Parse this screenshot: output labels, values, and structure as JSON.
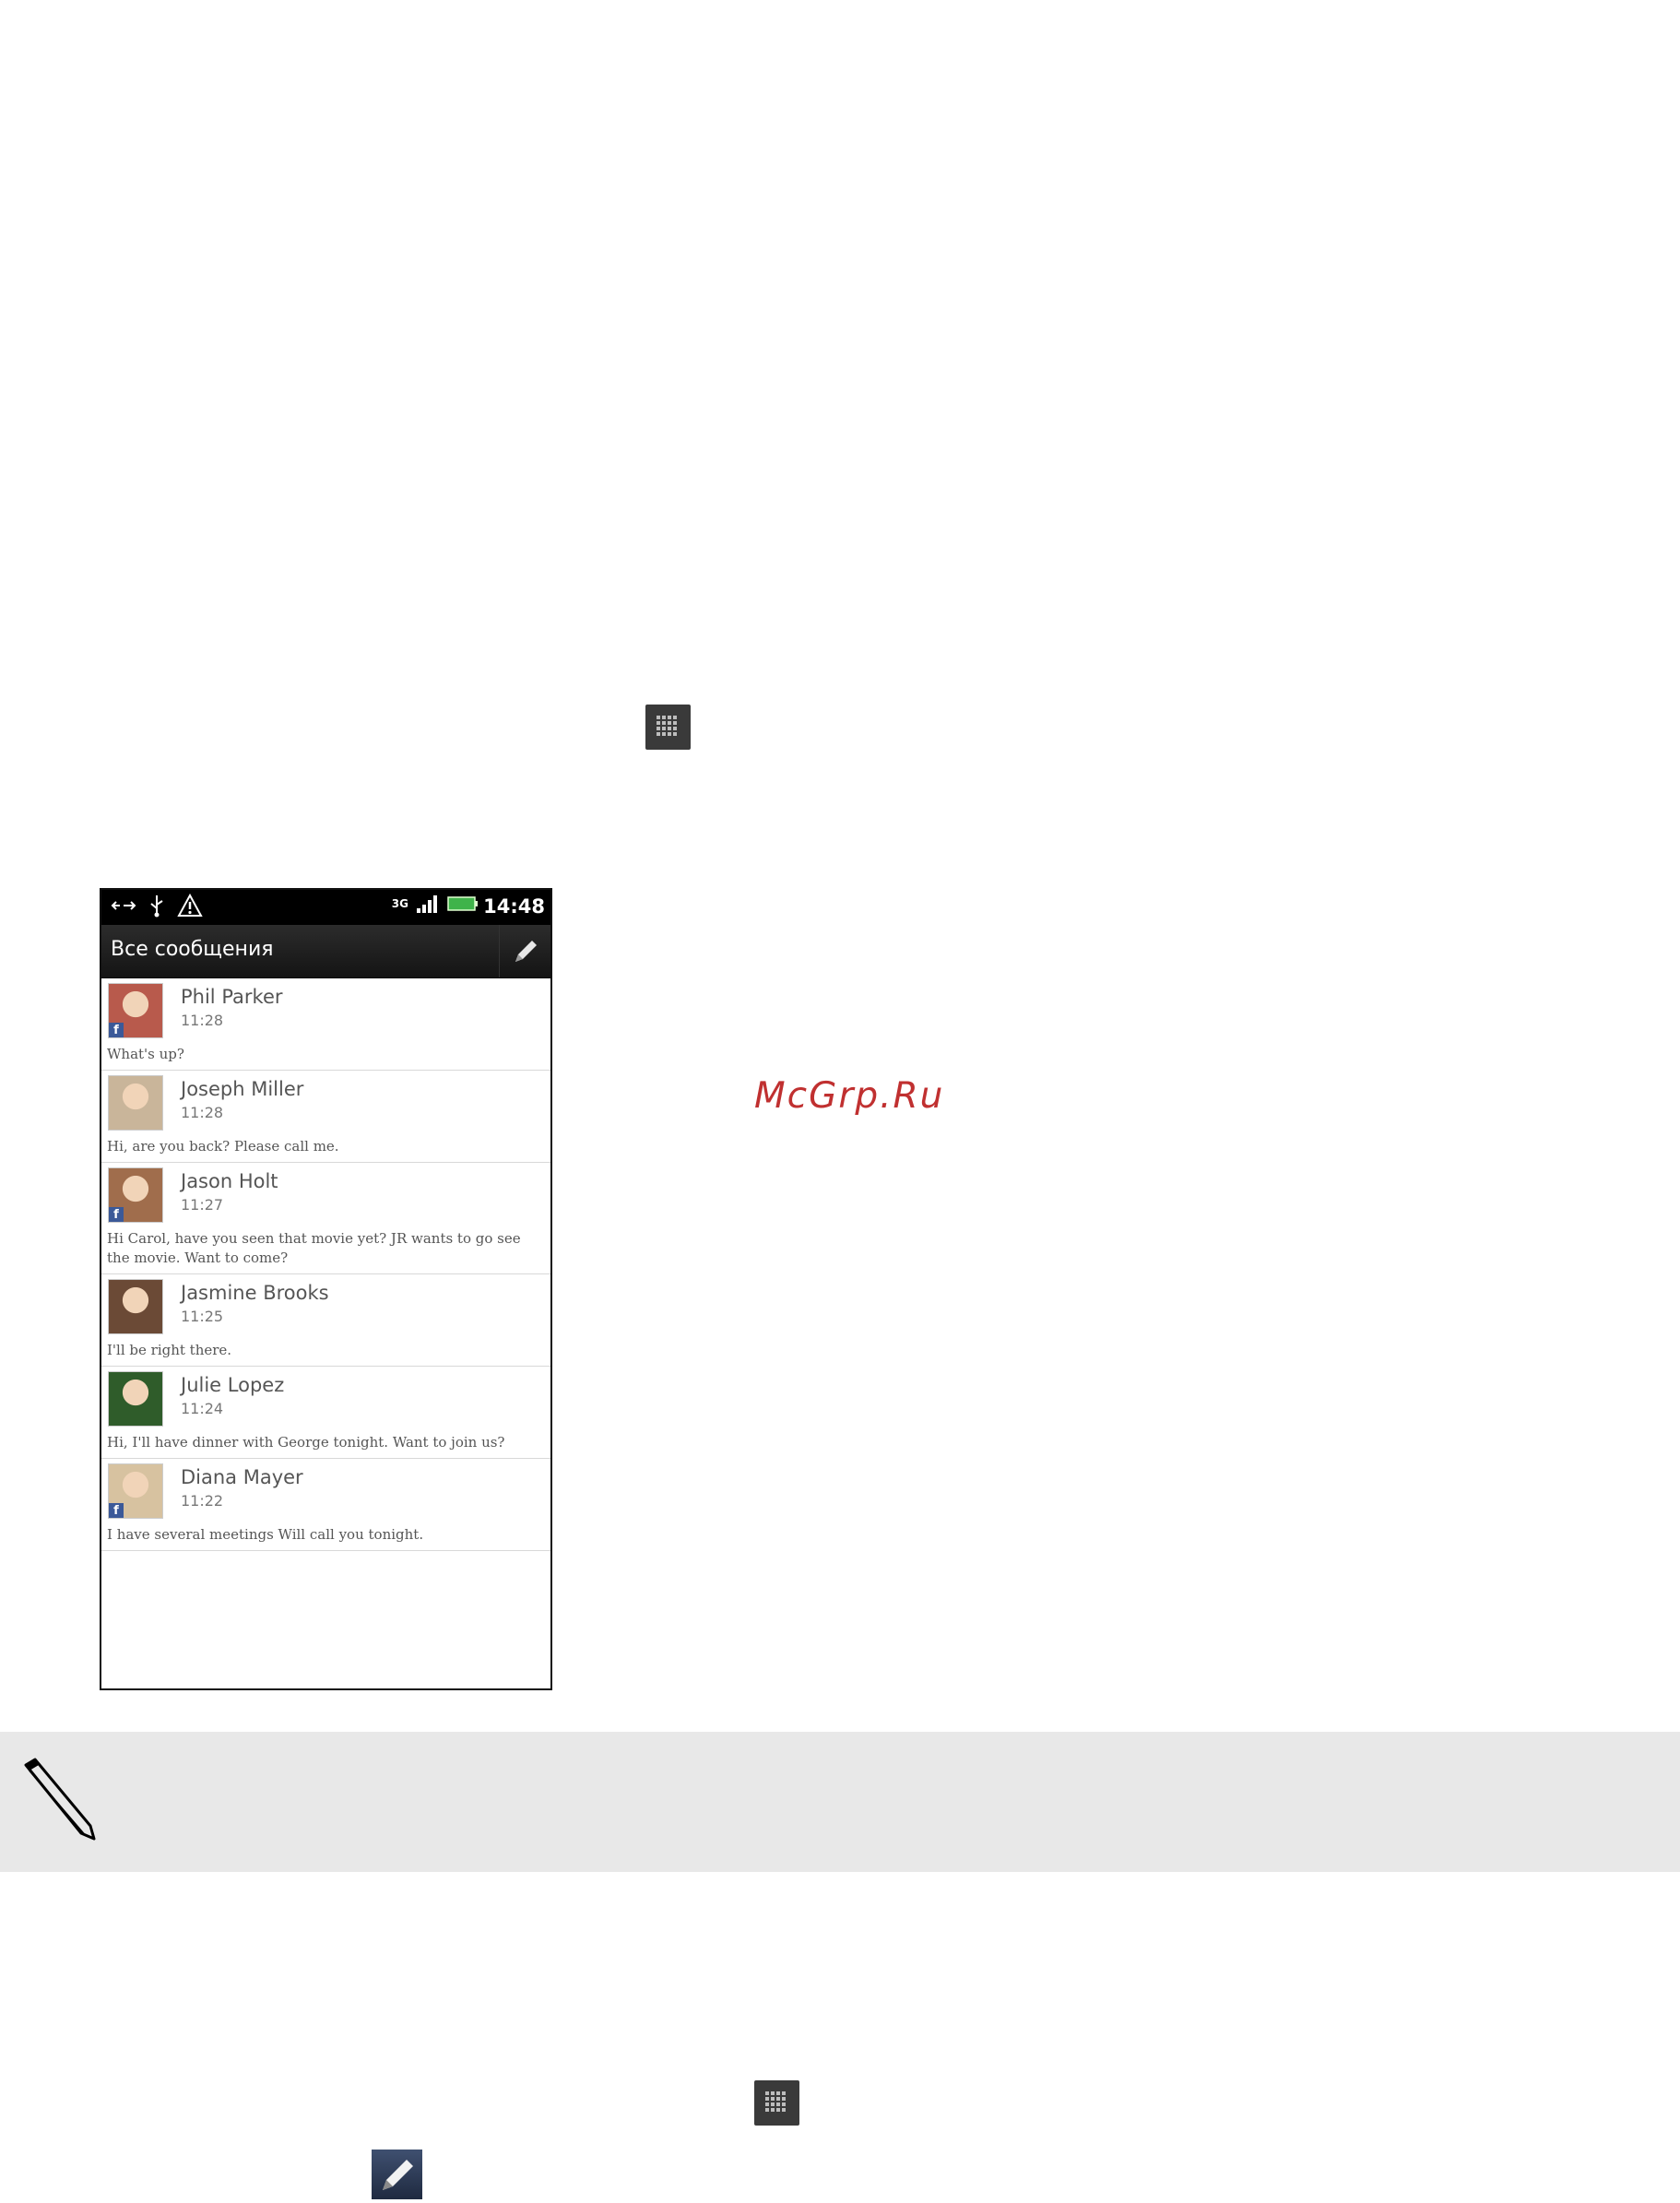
{
  "watermark": "McGrp.Ru",
  "icons": {
    "apps_icon": "grid-icon",
    "compose_icon": "pencil-icon",
    "note_icon": "pencil-icon"
  },
  "phone": {
    "status": {
      "time": "14:48",
      "network": "3G"
    },
    "title": "Все сообщения",
    "messages": [
      {
        "name": "Phil Parker",
        "time": "11:28",
        "preview": "What's up?",
        "facebook": true,
        "avatar_bg": "#b85a4c"
      },
      {
        "name": "Joseph Miller",
        "time": "11:28",
        "preview": "Hi, are you back? Please call me.",
        "facebook": false,
        "avatar_bg": "#c9b59a"
      },
      {
        "name": "Jason Holt",
        "time": "11:27",
        "preview": "Hi Carol, have you seen that movie yet? JR wants to go see the movie. Want to come?",
        "facebook": true,
        "avatar_bg": "#a06d4c"
      },
      {
        "name": "Jasmine Brooks",
        "time": "11:25",
        "preview": "I'll be right there.",
        "facebook": false,
        "avatar_bg": "#6b4a36"
      },
      {
        "name": "Julie Lopez",
        "time": "11:24",
        "preview": "Hi, I'll have dinner with George tonight. Want to join us?",
        "facebook": false,
        "avatar_bg": "#2f5c2a"
      },
      {
        "name": "Diana Mayer",
        "time": "11:22",
        "preview": "I have several meetings  Will call you tonight.",
        "facebook": true,
        "avatar_bg": "#d7c2a0"
      }
    ]
  }
}
